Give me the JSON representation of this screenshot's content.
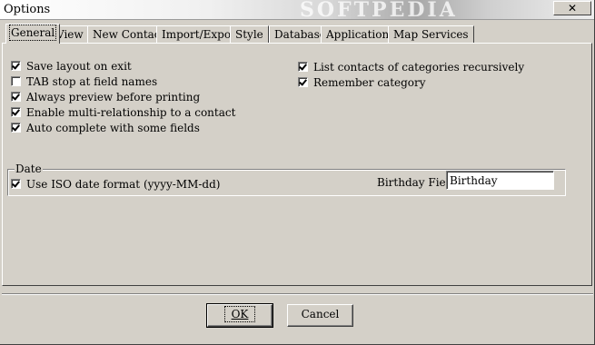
{
  "window": {
    "title": "Options",
    "watermark": "SOFTPEDIA",
    "close_glyph": "✕"
  },
  "tabs": [
    {
      "label": "General",
      "active": true
    },
    {
      "label": "View",
      "active": false
    },
    {
      "label": "New Contact",
      "active": false
    },
    {
      "label": "Import/Export",
      "active": false
    },
    {
      "label": "Style",
      "active": false
    },
    {
      "label": "Database",
      "active": false
    },
    {
      "label": "Applications",
      "active": false
    },
    {
      "label": "Map Services",
      "active": false
    }
  ],
  "general": {
    "left_options": [
      {
        "label": "Save layout on exit",
        "checked": true
      },
      {
        "label": "TAB stop at field names",
        "checked": false
      },
      {
        "label": "Always preview before printing",
        "checked": true
      },
      {
        "label": "Enable multi-relationship to a contact",
        "checked": true
      },
      {
        "label": "Auto complete with some fields",
        "checked": true
      }
    ],
    "right_options": [
      {
        "label": "List contacts of categories recursively",
        "checked": true
      },
      {
        "label": "Remember category",
        "checked": true
      }
    ]
  },
  "date": {
    "group_label": "Date",
    "iso_label": "Use ISO date format (yyyy-MM-dd)",
    "iso_checked": true,
    "birthday_label": "Birthday Field:",
    "birthday_value": "Birthday"
  },
  "buttons": {
    "ok_label": "OK",
    "cancel_label": "Cancel"
  },
  "icons": {
    "close": "close-icon",
    "checkmark": "checkmark-icon"
  }
}
